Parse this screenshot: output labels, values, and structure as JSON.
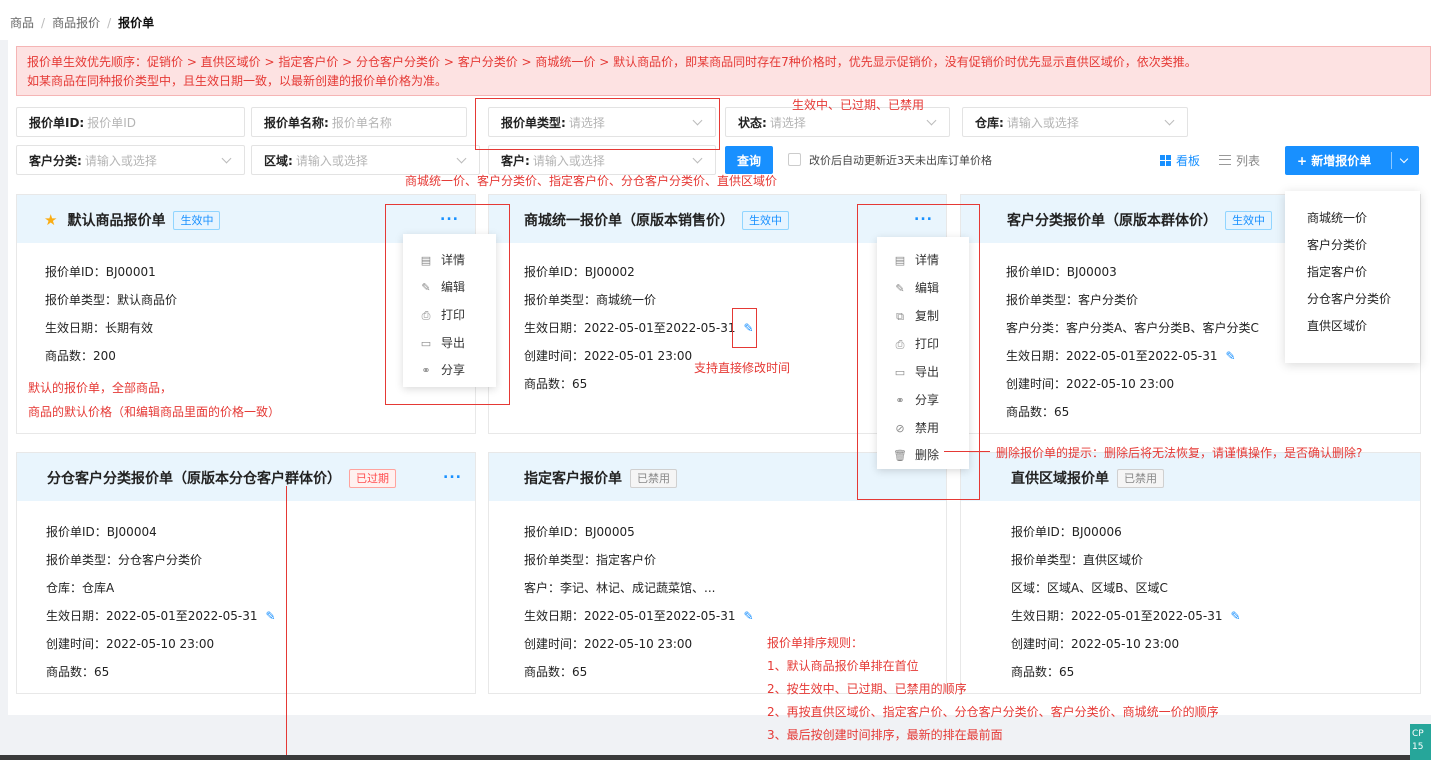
{
  "breadcrumb": [
    "商品",
    "商品报价",
    "报价单"
  ],
  "notice": {
    "line1": "报价单生效优先顺序：促销价 > 直供区域价 > 指定客户价 > 分仓客户分类价 > 客户分类价 > 商城统一价 > 默认商品价，即某商品同时存在7种价格时，优先显示促销价，没有促销价时优先显示直供区域价，依次类推。",
    "line2": "如某商品在同种报价类型中，且生效日期一致，以最新创建的报价单价格为准。"
  },
  "filters": {
    "id": {
      "label": "报价单ID:",
      "placeholder": "报价单ID"
    },
    "name": {
      "label": "报价单名称:",
      "placeholder": "报价单名称"
    },
    "type": {
      "label": "报价单类型:",
      "placeholder": "请选择"
    },
    "status": {
      "label": "状态:",
      "placeholder": "请选择"
    },
    "warehouse": {
      "label": "仓库:",
      "placeholder": "请输入或选择"
    },
    "customer_category": {
      "label": "客户分类:",
      "placeholder": "请输入或选择"
    },
    "region": {
      "label": "区域:",
      "placeholder": "请输入或选择"
    },
    "customer": {
      "label": "客户:",
      "placeholder": "请输入或选择"
    }
  },
  "toolbar": {
    "query": "查询",
    "auto_update": "改价后自动更新近3天未出库订单价格",
    "board": "看板",
    "list": "列表",
    "add": "+ 新增报价单"
  },
  "add_menu": [
    "商城统一价",
    "客户分类价",
    "指定客户价",
    "分仓客户分类价",
    "直供区域价"
  ],
  "cards": {
    "c1": {
      "title": "默认商品报价单",
      "status": "生效中",
      "id": "报价单ID：BJ00001",
      "type": "报价单类型：默认商品价",
      "date": "生效日期：长期有效",
      "count": "商品数：200"
    },
    "c2": {
      "title": "商城统一报价单（原版本销售价）",
      "status": "生效中",
      "id": "报价单ID：BJ00002",
      "type": "报价单类型：商城统一价",
      "date": "生效日期：2022-05-01至2022-05-31",
      "created": "创建时间：2022-05-01 23:00",
      "count": "商品数：65"
    },
    "c3": {
      "title": "客户分类报价单（原版本群体价）",
      "status": "生效中",
      "id": "报价单ID：BJ00003",
      "type": "报价单类型：客户分类价",
      "extra": "客户分类：客户分类A、客户分类B、客户分类C",
      "date": "生效日期：2022-05-01至2022-05-31",
      "created": "创建时间：2022-05-10 23:00",
      "count": "商品数：65"
    },
    "c4": {
      "title": "分仓客户分类报价单（原版本分仓客户群体价）",
      "status": "已过期",
      "id": "报价单ID：BJ00004",
      "type": "报价单类型：分仓客户分类价",
      "extra": "仓库：仓库A",
      "date": "生效日期：2022-05-01至2022-05-31",
      "created": "创建时间：2022-05-10 23:00",
      "count": "商品数：65"
    },
    "c5": {
      "title": "指定客户报价单",
      "status": "已禁用",
      "id": "报价单ID：BJ00005",
      "type": "报价单类型：指定客户价",
      "extra": "客户：李记、林记、成记蔬菜馆、...",
      "date": "生效日期：2022-05-01至2022-05-31",
      "created": "创建时间：2022-05-10 23:00",
      "count": "商品数：65"
    },
    "c6": {
      "title": "直供区域报价单",
      "status": "已禁用",
      "id": "报价单ID：BJ00006",
      "type": "报价单类型：直供区域价",
      "extra": "区域：区域A、区域B、区域C",
      "date": "生效日期：2022-05-01至2022-05-31",
      "created": "创建时间：2022-05-10 23:00",
      "count": "商品数：65"
    }
  },
  "menu1": [
    "详情",
    "编辑",
    "打印",
    "导出",
    "分享"
  ],
  "menu2": [
    "详情",
    "编辑",
    "复制",
    "打印",
    "导出",
    "分享",
    "禁用",
    "删除"
  ],
  "more": "...",
  "annotations": {
    "status_opts": "生效中、已过期、已禁用",
    "type_opts": "商城统一价、客户分类价、指定客户价、分仓客户分类价、直供区域价",
    "default_note1": "默认的报价单，全部商品，",
    "default_note2": "商品的默认价格（和编辑商品里面的价格一致）",
    "edit_time": "支持直接修改时间",
    "delete_tip": "删除报价单的提示：删除后将无法恢复，请谨慎操作，是否确认删除?",
    "sort_title": "报价单排序规则：",
    "sort1": "1、默认商品报价单排在首位",
    "sort2": "2、按生效中、已过期、已禁用的顺序",
    "sort3": "2、再按直供区域价、指定客户价、分仓客户分类价、客户分类价、商城统一价的顺序",
    "sort4": "3、最后按创建时间排序，最新的排在最前面"
  },
  "cp_badge": "CP 15"
}
